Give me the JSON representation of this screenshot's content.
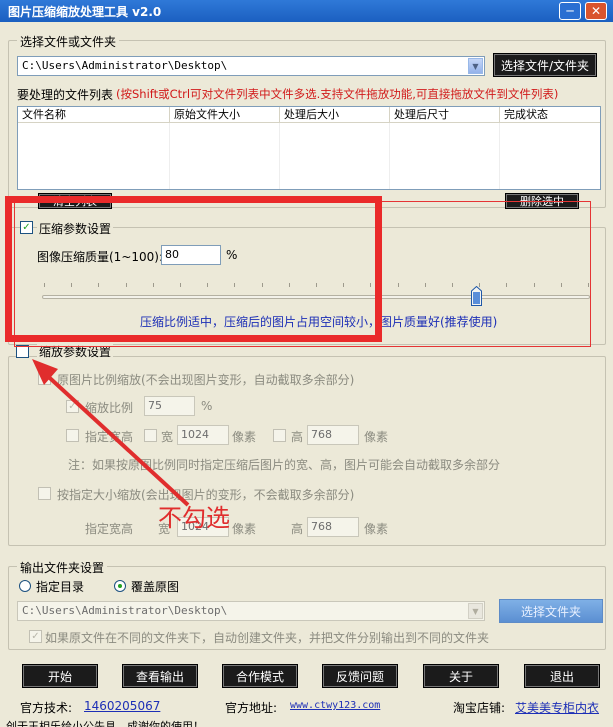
{
  "window": {
    "title": "图片压缩缩放处理工具 v2.0",
    "min_glyph": "─",
    "close_glyph": "✕"
  },
  "select_group": {
    "legend": "选择文件或文件夹",
    "path_value": "C:\\Users\\Administrator\\Desktop\\",
    "select_button": "选择文件/文件夹"
  },
  "file_list": {
    "label": "要处理的文件列表",
    "hint": "(按Shift或Ctrl可对文件列表中文件多选.支持文件拖放功能,可直接拖放文件到文件列表)",
    "columns": [
      "文件名称",
      "原始文件大小",
      "处理后大小",
      "处理后尺寸",
      "完成状态"
    ],
    "clear_button": "清空列表",
    "delete_button": "删除选中"
  },
  "compress": {
    "checkbox_label": "压缩参数设置",
    "checked": true,
    "quality_label": "图像压缩质量(1~100):",
    "quality_value": "80",
    "unit": "%",
    "slider_value_percent": 80,
    "hint": "压缩比例适中，压缩后的图片占用空间较小，图片质量好(推荐使用)"
  },
  "scale": {
    "checkbox_label": "缩放参数设置",
    "checked": false,
    "keep_ratio_label": "原图片比例缩放(不会出现图片变形，自动截取多余部分)",
    "ratio_label": "缩放比例",
    "ratio_value": "75",
    "ratio_unit": "%",
    "specify_label": "指定宽高",
    "width_label": "宽",
    "width_value": "1024",
    "pixel_unit": "像素",
    "height_label": "高",
    "height_value": "768",
    "note": "注：如果按原图比例同时指定压缩后图片的宽、高，图片可能会自动截取多余部分",
    "fixed_size_label": "按指定大小缩放(会出现图片的变形，不会截取多余部分)",
    "fixed_specify_label": "指定宽高",
    "fixed_width_label": "宽",
    "fixed_width_value": "1024",
    "fixed_height_label": "高",
    "fixed_height_value": "768"
  },
  "annotation": {
    "text": "不勾选"
  },
  "output": {
    "legend": "输出文件夹设置",
    "radio_specify": "指定目录",
    "radio_overwrite": "覆盖原图",
    "path_value": "C:\\Users\\Administrator\\Desktop\\",
    "select_folder_button": "选择文件夹",
    "auto_create_label": "如果原文件在不同的文件夹下，自动创建文件夹，并把文件分别输出到不同的文件夹"
  },
  "buttons": {
    "start": "开始",
    "view_output": "查看输出",
    "cooperation": "合作模式",
    "feedback": "反馈问题",
    "about": "关于",
    "exit": "退出"
  },
  "footer": {
    "support_label": "官方技术:",
    "support_value": "1460205067",
    "site_label": "官方地址:",
    "site_value": "www.ctwy123.com",
    "shop_label": "淘宝店铺:",
    "shop_value": "艾美美专柜内衣",
    "status_text": "创于王相乐给小公先具，成谢你的使用！"
  }
}
